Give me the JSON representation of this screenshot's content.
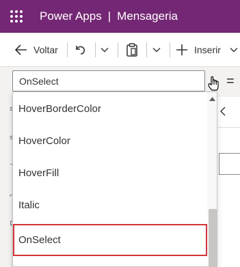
{
  "header": {
    "app_name": "Power Apps",
    "separator": "|",
    "app_title": "Mensageria"
  },
  "toolbar": {
    "back_label": "Voltar",
    "insert_label": "Inserir",
    "icons": [
      "arrow-left-icon",
      "undo-icon",
      "chevron-down-icon",
      "paste-icon",
      "chevron-down-icon",
      "plus-icon",
      "chevron-down-icon"
    ]
  },
  "formula_bar": {
    "property_value": "OnSelect",
    "equals": "="
  },
  "dropdown": {
    "options": [
      "HoverBorderColor",
      "HoverColor",
      "HoverFill",
      "Italic",
      "OnSelect"
    ],
    "selected": "OnSelect",
    "scroll_fraction": 1.0
  },
  "colors": {
    "header_bg": "#742774",
    "selection_border": "#d13438",
    "text": "#323130"
  }
}
